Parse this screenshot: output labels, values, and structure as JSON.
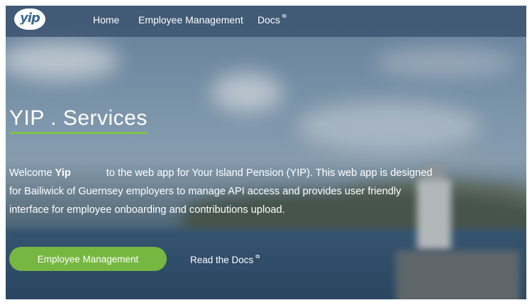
{
  "nav": {
    "logo_text": "yip",
    "items": [
      {
        "label": "Home"
      },
      {
        "label": "Employee Management"
      },
      {
        "label": "Docs",
        "external": true
      }
    ]
  },
  "hero": {
    "title": "YIP . Services",
    "intro_prefix": "Welcome",
    "intro_name": "Yip",
    "intro_body": "to the web app for Your Island Pension (YIP). This web app is designed for Bailiwick of Guernsey employers to manage API access and provides user friendly interface for employee onboarding and contributions upload.",
    "primary_button": "Employee Management",
    "docs_link": "Read the Docs"
  },
  "icons": {
    "external_link": "external-link-icon"
  },
  "colors": {
    "accent_green": "#76b741",
    "underline_green": "#7dc24a",
    "navbar_bg": "#37506c",
    "logo_text": "#3c6a8e"
  }
}
